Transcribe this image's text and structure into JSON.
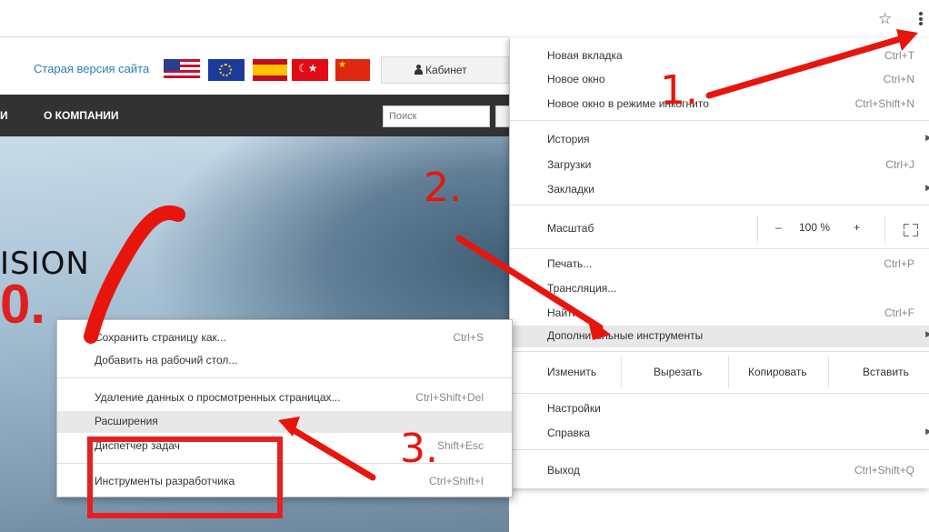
{
  "toolbar": {
    "star_icon": "star-icon",
    "menu_icon": "more-vert-icon"
  },
  "site": {
    "old_version_link": "Старая версия сайта",
    "cabinet_label": "Кабинет",
    "nav_partial": "И",
    "nav_company": "О КОМПАНИИ",
    "search_placeholder": "Поиск",
    "hero_text": "ISION",
    "hero_red": "0.",
    "flags": [
      "us",
      "eu",
      "es",
      "tr",
      "cn"
    ]
  },
  "menu": {
    "new_tab": {
      "label": "Новая вкладка",
      "shortcut": "Ctrl+T"
    },
    "new_window": {
      "label": "Новое окно",
      "shortcut": "Ctrl+N"
    },
    "incognito": {
      "label": "Новое окно в режиме инкогнито",
      "shortcut": "Ctrl+Shift+N"
    },
    "history": {
      "label": "История"
    },
    "downloads": {
      "label": "Загрузки",
      "shortcut": "Ctrl+J"
    },
    "bookmarks": {
      "label": "Закладки"
    },
    "zoom": {
      "label": "Масштаб",
      "minus": "–",
      "value": "100 %",
      "plus": "+"
    },
    "print": {
      "label": "Печать...",
      "shortcut": "Ctrl+P"
    },
    "cast": {
      "label": "Трансляция..."
    },
    "find": {
      "label": "Найти...",
      "shortcut": "Ctrl+F"
    },
    "more_tools": {
      "label": "Дополнительные инструменты"
    },
    "edit": {
      "label": "Изменить",
      "cut": "Вырезать",
      "copy": "Копировать",
      "paste": "Вставить"
    },
    "settings": {
      "label": "Настройки"
    },
    "help": {
      "label": "Справка"
    },
    "exit": {
      "label": "Выход",
      "shortcut": "Ctrl+Shift+Q"
    }
  },
  "submenu": {
    "save_page": {
      "label": "Сохранить страницу как...",
      "shortcut": "Ctrl+S"
    },
    "add_to_desktop": {
      "label": "Добавить на рабочий стол..."
    },
    "clear_data": {
      "label": "Удаление данных о просмотренных страницах...",
      "shortcut": "Ctrl+Shift+Del"
    },
    "extensions": {
      "label": "Расширения"
    },
    "task_manager": {
      "label": "Диспетчер задач",
      "shortcut": "Shift+Esc"
    },
    "dev_tools": {
      "label": "Инструменты разработчика",
      "shortcut": "Ctrl+Shift+I"
    }
  },
  "annotations": {
    "step1": "1.",
    "step2": "2.",
    "step3": "3.",
    "color": "#e8150d"
  }
}
